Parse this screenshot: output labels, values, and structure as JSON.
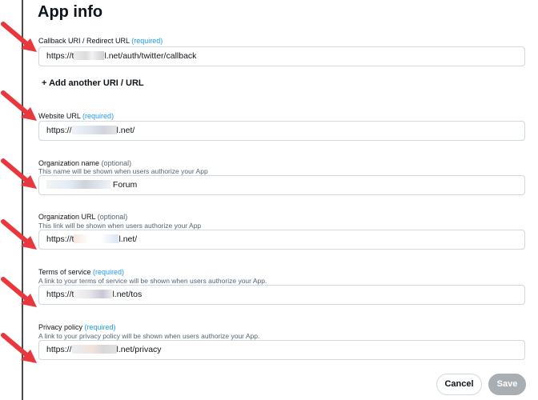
{
  "header": {
    "title": "App info"
  },
  "callback": {
    "label": "Callback URI / Redirect URL",
    "tag": "(required)",
    "prefix": "https://t",
    "suffix": "l.net/auth/twitter/callback"
  },
  "add_uri": {
    "label": "+ Add another URI / URL"
  },
  "website": {
    "label": "Website URL",
    "tag": "(required)",
    "prefix": "https://",
    "suffix": "l.net/"
  },
  "org_name": {
    "label": "Organization name",
    "tag": "(optional)",
    "hint": "This name will be shown when users authorize your App",
    "suffix": "Forum"
  },
  "org_url": {
    "label": "Organization URL",
    "tag": "(optional)",
    "hint": "This link will be shown when users authorize your App",
    "prefix": "https://t",
    "suffix": "l.net/"
  },
  "tos": {
    "label": "Terms of service",
    "tag": "(required)",
    "hint": "A link to your terms of service will be shown when users authorize your App.",
    "prefix": "https://t",
    "suffix": "l.net/tos"
  },
  "privacy": {
    "label": "Privacy policy",
    "tag": "(required)",
    "hint": "A link to your privacy policy will be shown when users authorize your App.",
    "prefix": "https://",
    "suffix": "l.net/privacy"
  },
  "actions": {
    "cancel": "Cancel",
    "save": "Save"
  },
  "colors": {
    "accent": "#1d9bf0",
    "arrow": "#e8383d",
    "save_disabled": "#a9aeb2"
  }
}
